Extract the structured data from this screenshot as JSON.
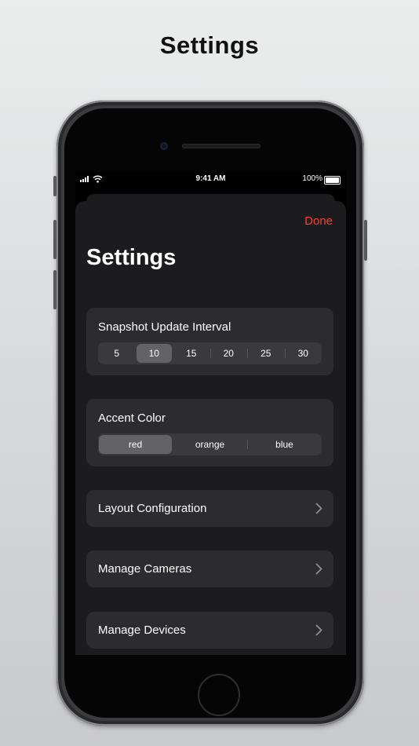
{
  "headline": "Settings",
  "status_bar": {
    "time": "9:41 AM",
    "battery": "100%"
  },
  "sheet": {
    "done_label": "Done",
    "title": "Settings",
    "snapshot": {
      "label": "Snapshot Update Interval",
      "options": [
        "5",
        "10",
        "15",
        "20",
        "25",
        "30"
      ],
      "selected": "10"
    },
    "accent": {
      "label": "Accent Color",
      "options": [
        "red",
        "orange",
        "blue"
      ],
      "selected": "red"
    },
    "rows": [
      {
        "label": "Layout Configuration"
      },
      {
        "label": "Manage Cameras"
      },
      {
        "label": "Manage Devices"
      }
    ]
  },
  "colors": {
    "accent": "#ff3b30",
    "card": "#2c2c2e",
    "sheet": "#1c1c1e",
    "selected_segment": "#636366"
  },
  "icons": [
    "signal-icon",
    "wifi-icon",
    "battery-icon",
    "chevron-right-icon"
  ]
}
